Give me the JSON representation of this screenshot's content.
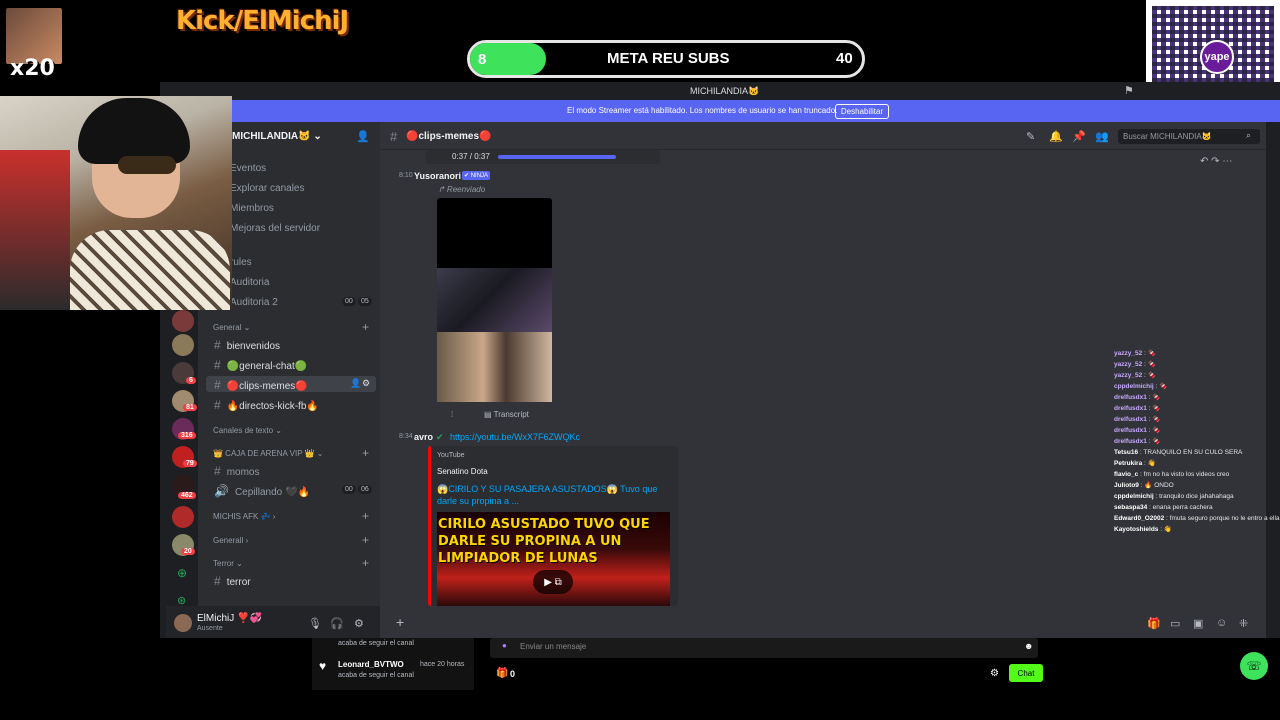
{
  "overlay": {
    "kick_title": "Kick/ElMichiJ",
    "multiplier": "x20",
    "meta_current": "8",
    "meta_label": "META REU SUBS",
    "meta_goal": "40",
    "meta_progress": 0.2,
    "qr_badge": "yape"
  },
  "window": {
    "title": "MICHILANDIA🐱",
    "banner_text": "El modo Streamer está habilitado. Los nombres de usuario se han truncado.",
    "banner_button": "Deshabilitar"
  },
  "servers": {
    "badges": [
      "6",
      "81",
      "316",
      "79",
      "462",
      "20"
    ]
  },
  "sidebar": {
    "server_name": "MICHILANDIA🐱 ⌄",
    "nav": [
      "Eventos",
      "Explorar canales",
      "Miembros",
      "Mejoras del servidor"
    ],
    "voice_top": [
      {
        "name": "rules"
      },
      {
        "name": "Auditoria"
      },
      {
        "name": "Auditoria 2",
        "count_a": "00",
        "count_b": "05"
      }
    ],
    "cat_general": "General ⌄",
    "channels_general": [
      "bienvenidos",
      "🟢general-chat🟢",
      "🔴clips-memes🔴",
      "🔥directos-kick-fb🔥"
    ],
    "cat_texto": "Canales de texto ⌄",
    "cat_vip": "👑 CAJA DE ARENA VIP 👑 ⌄",
    "chan_momos": "momos",
    "voice_cepillando": "Cepillando 🖤🔥",
    "cepillando_a": "00",
    "cepillando_b": "06",
    "cat_afk": "MICHIS AFK 💤 ›",
    "cat_generall": "Generall ›",
    "cat_terror": "Terror ⌄",
    "chan_terror": "terror"
  },
  "userbar": {
    "name": "ElMichiJ ❣️💞",
    "status": "Ausente"
  },
  "channel": {
    "name": "🔴clips-memes🔴",
    "search_placeholder": "Buscar MICHILANDIA🐱"
  },
  "messages": {
    "audio_time": "0:37 / 0:37",
    "m1_time": "8:10",
    "m1_author": "Yusoranori",
    "m1_tag": "✔ NINJA",
    "m1_forwarded": "↱ Reenviado",
    "m1_transcript": "Transcript",
    "m2_time": "8:34",
    "m2_author": "avro",
    "m2_link": "https://youtu.be/WxX7F6ZWQKc",
    "embed_provider": "YouTube",
    "embed_author": "Senatino Dota",
    "embed_title": "😱CIRILO Y SU PASAJERA ASUSTADOS😱 Tuvo que darle su propina a ...",
    "embed_caption": "CIRILO ASUSTADO TUVO QUE DARLE SU PROPINA A UN LIMPIADOR DE LUNAS"
  },
  "kick_chat": [
    {
      "user": "yazzy_52",
      "text": "🍫"
    },
    {
      "user": "yazzy_52",
      "text": "🍫"
    },
    {
      "user": "yazzy_52",
      "text": "🍫"
    },
    {
      "user": "cppdelmichij",
      "text": "🍫"
    },
    {
      "user": "drelfusdx1",
      "text": "🍫"
    },
    {
      "user": "drelfusdx1",
      "text": "🍫"
    },
    {
      "user": "drelfusdx1",
      "text": "🍫"
    },
    {
      "user": "drelfusdx1",
      "text": "🍫"
    },
    {
      "user": "drelfusdx1",
      "text": "🍫"
    },
    {
      "user": "Tetsu16",
      "text": "TRANQUILO EN SU CULO SERA"
    },
    {
      "user": "Petrukira",
      "text": "👋"
    },
    {
      "user": "flavio_c",
      "text": "fm no ha visto los videos creo"
    },
    {
      "user": "Julioto9",
      "text": "🔥 ONDO"
    },
    {
      "user": "cppdelmichij",
      "text": "tranquilo dice jahahahaga"
    },
    {
      "user": "sebaspa34",
      "text": "enana perra cachera"
    },
    {
      "user": "Edward0_O2002",
      "text": "fmuta seguro porque no le entro a ella dice que es tranquilo"
    },
    {
      "user": "Kayotoshields",
      "text": "👋"
    }
  ],
  "bottom": {
    "follow_prev": "acaba de seguir el canal",
    "follow_name": "Leonard_BVTWO",
    "follow_ago": "hace 20 horas",
    "follow_action": "acaba de seguir el canal",
    "chat_placeholder": "Enviar un mensaje",
    "gift_count": "0",
    "chat_button": "Chat"
  }
}
